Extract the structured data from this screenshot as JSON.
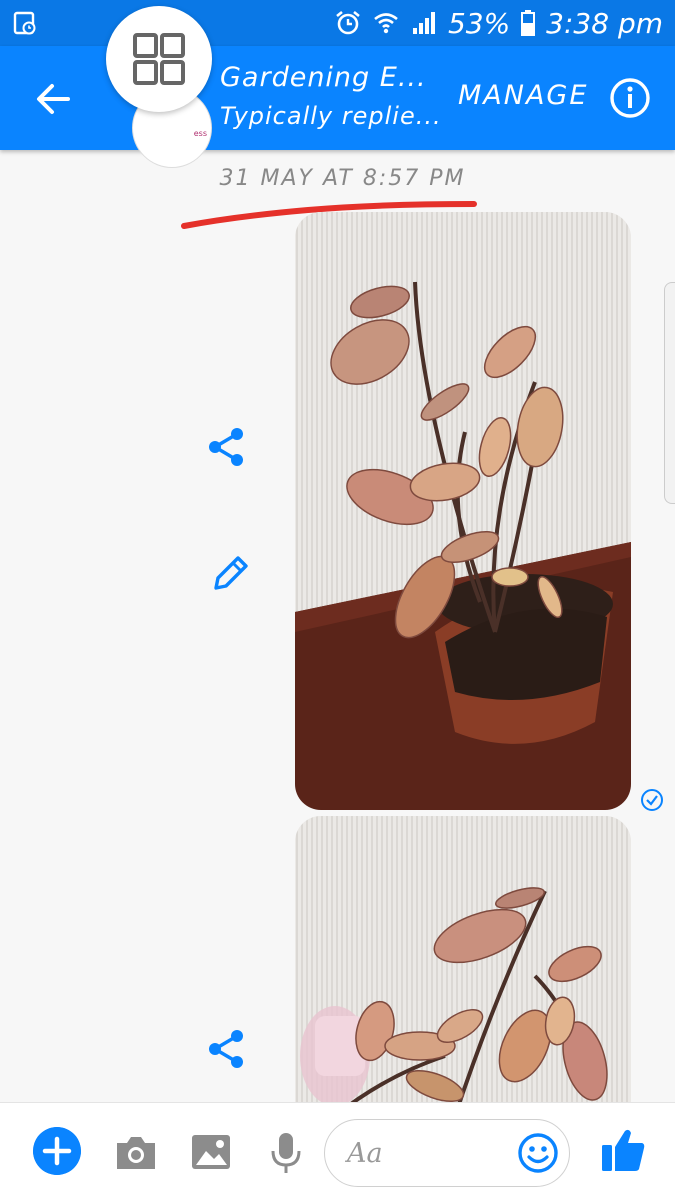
{
  "status_bar": {
    "battery_percent": "53%",
    "time": "3:38 pm",
    "icons": [
      "screenshot-icon",
      "alarm-icon",
      "wifi-icon",
      "signal-icon",
      "battery-icon"
    ]
  },
  "header": {
    "title": "Gardening E...",
    "subtitle": "Typically replie...",
    "manage_label": "MANAGE",
    "icons": [
      "back-arrow-icon",
      "grid-icon",
      "info-icon"
    ],
    "accent_color": "#0a84ff"
  },
  "conversation": {
    "timestamp": "31 MAY AT 8:57 PM",
    "annotation_color": "#e5312a",
    "messages": [
      {
        "type": "photo",
        "subject": "potted plant with pink leaves",
        "actions": [
          "share-icon",
          "edit-icon"
        ],
        "status": "seen-check-icon"
      },
      {
        "type": "photo",
        "subject": "potted plant with pink leaves",
        "actions": [
          "share-icon"
        ]
      }
    ]
  },
  "composer": {
    "placeholder": "Aa",
    "icons": [
      "plus-icon",
      "camera-icon",
      "gallery-icon",
      "microphone-icon",
      "emoji-icon",
      "thumbs-up-icon"
    ]
  }
}
